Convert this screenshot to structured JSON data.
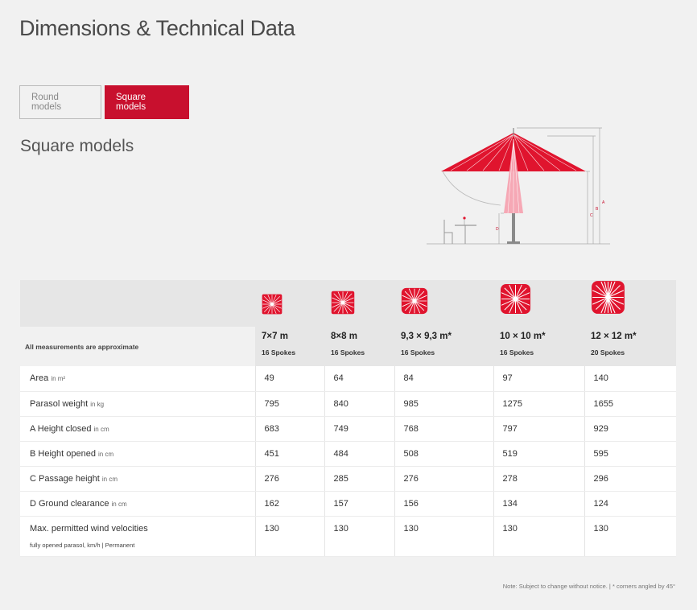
{
  "page": {
    "title": "Dimensions & Technical Data"
  },
  "tabs": [
    {
      "label": "Round models",
      "active": false
    },
    {
      "label": "Square models",
      "active": true
    }
  ],
  "section": {
    "title": "Square models"
  },
  "colors": {
    "accent": "#c8102e",
    "umbrella_red": "#e0142e",
    "umbrella_pink": "#f5a3b1"
  },
  "diagram": {
    "letters": [
      "A",
      "B",
      "C",
      "D"
    ]
  },
  "table": {
    "note_header": "All measurements are approximate",
    "columns": [
      {
        "size": "7×7 m",
        "spokes": "16 Spokes",
        "icon": "square-umbrella-icon"
      },
      {
        "size": "8×8 m",
        "spokes": "16 Spokes",
        "icon": "square-umbrella-icon"
      },
      {
        "size": "9,3 × 9,3 m*",
        "spokes": "16 Spokes",
        "icon": "square-umbrella-icon"
      },
      {
        "size": "10 × 10 m*",
        "spokes": "16 Spokes",
        "icon": "square-umbrella-icon"
      },
      {
        "size": "12 × 12 m*",
        "spokes": "20 Spokes",
        "icon": "square-umbrella-icon"
      }
    ],
    "rows": [
      {
        "label": "Area",
        "unit": "in m²",
        "sub": "",
        "values": [
          "49",
          "64",
          "84",
          "97",
          "140"
        ]
      },
      {
        "label": "Parasol weight",
        "unit": "in kg",
        "sub": "",
        "values": [
          "795",
          "840",
          "985",
          "1275",
          "1655"
        ]
      },
      {
        "label": "A Height closed",
        "unit": "in cm",
        "sub": "",
        "values": [
          "683",
          "749",
          "768",
          "797",
          "929"
        ]
      },
      {
        "label": "B Height opened",
        "unit": "in cm",
        "sub": "",
        "values": [
          "451",
          "484",
          "508",
          "519",
          "595"
        ]
      },
      {
        "label": "C Passage height",
        "unit": "in cm",
        "sub": "",
        "values": [
          "276",
          "285",
          "276",
          "278",
          "296"
        ]
      },
      {
        "label": "D Ground clearance",
        "unit": "in cm",
        "sub": "",
        "values": [
          "162",
          "157",
          "156",
          "134",
          "124"
        ]
      },
      {
        "label": "Max. permitted wind velocities",
        "unit": "",
        "sub": "fully opened parasol, km/h | Permanent",
        "values": [
          "130",
          "130",
          "130",
          "130",
          "130"
        ]
      }
    ]
  },
  "footer": {
    "note": "Note: Subject to change without notice. | * corners angled by 45°"
  }
}
